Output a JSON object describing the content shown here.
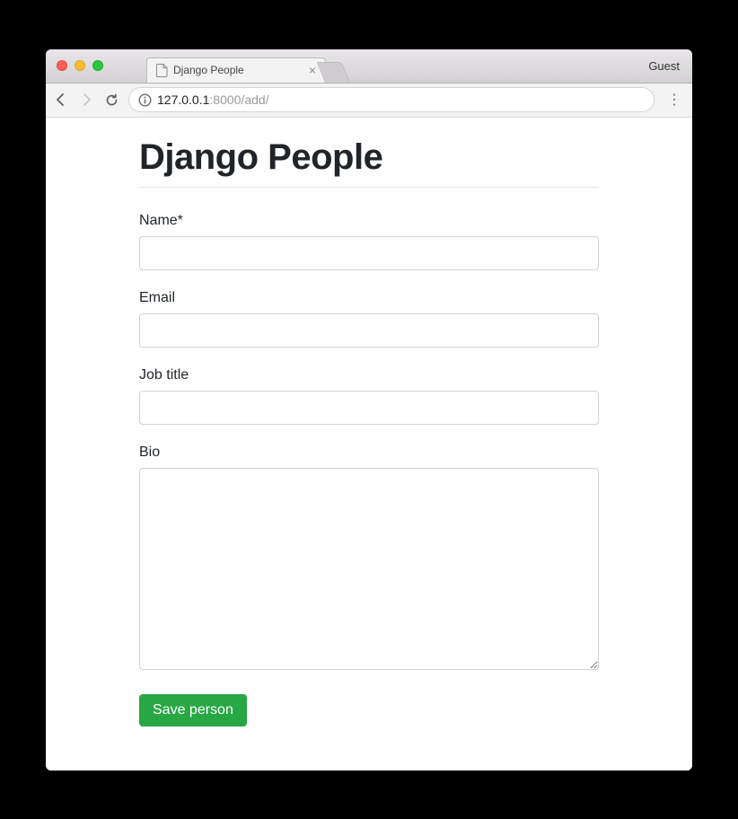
{
  "window": {
    "guest_label": "Guest"
  },
  "tab": {
    "title": "Django People"
  },
  "url": {
    "host": "127.0.0.1",
    "port_and_path": ":8000/add/"
  },
  "page": {
    "heading": "Django People"
  },
  "form": {
    "fields": [
      {
        "label": "Name*",
        "type": "text",
        "value": ""
      },
      {
        "label": "Email",
        "type": "text",
        "value": ""
      },
      {
        "label": "Job title",
        "type": "text",
        "value": ""
      },
      {
        "label": "Bio",
        "type": "textarea",
        "value": ""
      }
    ],
    "submit_label": "Save person"
  },
  "colors": {
    "success": "#28a745"
  }
}
